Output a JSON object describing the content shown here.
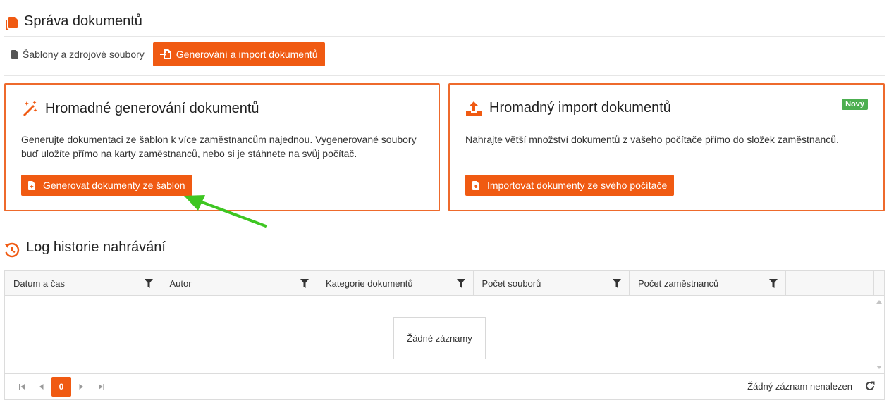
{
  "header": {
    "title": "Správa dokumentů",
    "icon": "documents-icon"
  },
  "tabs": {
    "templates_label": "Šablony a zdrojové soubory",
    "generate_label": "Generování a import dokumentů"
  },
  "generate_card": {
    "title": "Hromadné generování dokumentů",
    "description": "Generujte dokumentaci ze šablon k více zaměstnancům najednou. Vygenerované soubory buď uložíte přímo na karty zaměstnanců, nebo si je stáhnete na svůj počítač.",
    "button_label": "Generovat dokumenty ze šablon"
  },
  "import_card": {
    "title": "Hromadný import dokumentů",
    "badge": "Nový",
    "description": "Nahrajte větší množství dokumentů z vašeho počítače přímo do složek zaměstnanců.",
    "button_label": "Importovat dokumenty ze svého počítače"
  },
  "log": {
    "title": "Log historie nahrávání",
    "columns": [
      "Datum a čas",
      "Autor",
      "Kategorie dokumentů",
      "Počet souborů",
      "Počet zaměstnanců"
    ],
    "empty_text": "Žádné záznamy",
    "pager": {
      "current_page": "0",
      "info": "Žádný záznam nenalezen"
    }
  },
  "colors": {
    "accent": "#f05a12",
    "border": "#ee6a2c",
    "badge": "#4caf50",
    "annotation_arrow": "#3ec622"
  }
}
